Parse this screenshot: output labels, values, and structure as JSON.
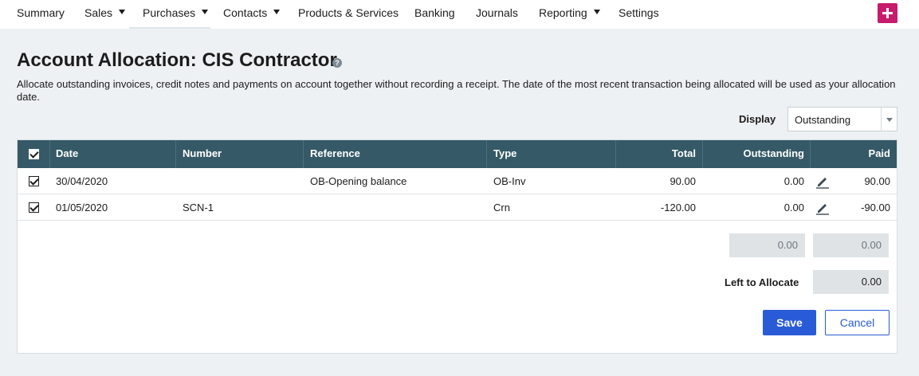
{
  "nav": {
    "items": [
      {
        "label": "Summary",
        "has_dropdown": false
      },
      {
        "label": "Sales",
        "has_dropdown": true
      },
      {
        "label": "Purchases",
        "has_dropdown": true
      },
      {
        "label": "Contacts",
        "has_dropdown": true
      },
      {
        "label": "Products & Services",
        "has_dropdown": false
      },
      {
        "label": "Banking",
        "has_dropdown": false
      },
      {
        "label": "Journals",
        "has_dropdown": false
      },
      {
        "label": "Reporting",
        "has_dropdown": true
      },
      {
        "label": "Settings",
        "has_dropdown": false
      }
    ],
    "active": "Purchases",
    "accent_color": "#c71b6c",
    "add_icon": "plus-icon"
  },
  "page": {
    "title": "Account Allocation: CIS Contractor",
    "help_icon_glyph": "?",
    "description": "Allocate outstanding invoices, credit notes and payments on account together without recording a receipt. The date of the most recent transaction being allocated will be used as your allocation date."
  },
  "display": {
    "label": "Display",
    "selected": "Outstanding"
  },
  "table": {
    "header_color": "#355966",
    "columns": {
      "date": "Date",
      "number": "Number",
      "reference": "Reference",
      "type": "Type",
      "total": "Total",
      "outstanding": "Outstanding",
      "paid": "Paid"
    },
    "rows": [
      {
        "checked": true,
        "date": "30/04/2020",
        "number": "",
        "reference": "OB-Opening balance",
        "type": "OB-Inv",
        "total": "90.00",
        "outstanding": "0.00",
        "paid": "90.00"
      },
      {
        "checked": true,
        "date": "01/05/2020",
        "number": "SCN-1",
        "reference": "",
        "type": "Crn",
        "total": "-120.00",
        "outstanding": "0.00",
        "paid": "-90.00"
      }
    ]
  },
  "summary": {
    "outstanding_total": "0.00",
    "paid_total": "0.00",
    "left_to_allocate_label": "Left to Allocate",
    "left_to_allocate": "0.00"
  },
  "actions": {
    "save_label": "Save",
    "cancel_label": "Cancel",
    "primary_color": "#2a5bd7"
  }
}
